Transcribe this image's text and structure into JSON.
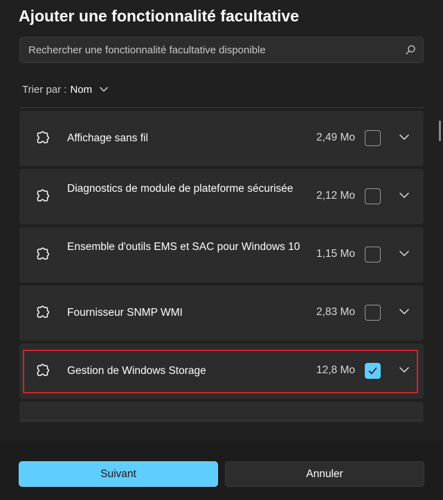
{
  "dialog": {
    "title": "Ajouter une fonctionnalité facultative"
  },
  "search": {
    "placeholder": "Rechercher une fonctionnalité facultative disponible",
    "icon": "search-icon"
  },
  "sort": {
    "label": "Trier par :",
    "value": "Nom"
  },
  "features": [
    {
      "name": "Affichage sans fil",
      "size": "2,49 Mo",
      "checked": false,
      "icon": "puzzle-icon"
    },
    {
      "name": "Diagnostics de module de plateforme sécurisée",
      "size": "2,12 Mo",
      "checked": false,
      "icon": "puzzle-icon"
    },
    {
      "name": "Ensemble d'outils EMS et SAC pour Windows 10",
      "size": "1,15 Mo",
      "checked": false,
      "icon": "puzzle-icon"
    },
    {
      "name": "Fournisseur SNMP WMI",
      "size": "2,83 Mo",
      "checked": false,
      "icon": "puzzle-icon"
    },
    {
      "name": "Gestion de Windows Storage",
      "size": "12,8 Mo",
      "checked": true,
      "icon": "puzzle-icon",
      "highlighted": true
    }
  ],
  "footer": {
    "next_label": "Suivant",
    "cancel_label": "Annuler"
  },
  "colors": {
    "accent": "#60cdff",
    "highlight": "#d1232b",
    "background": "#202020",
    "card": "#2c2c2c"
  }
}
